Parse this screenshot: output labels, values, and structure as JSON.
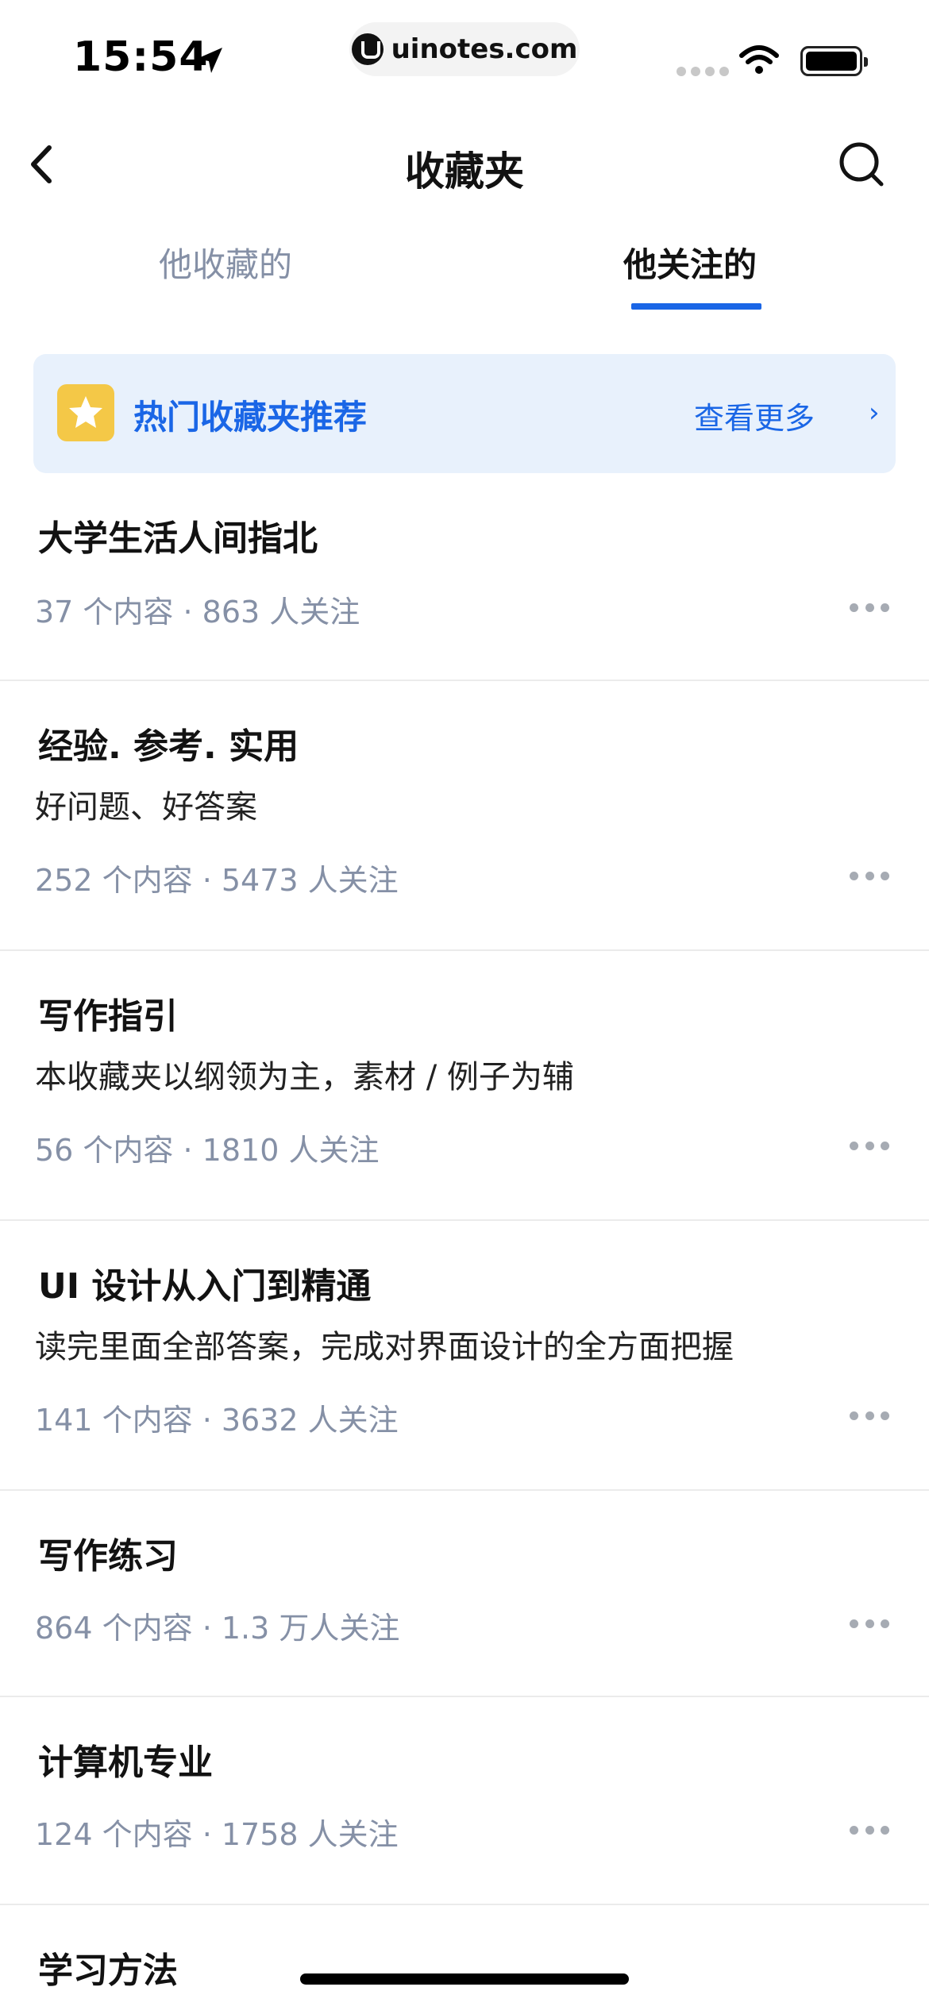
{
  "status_bar": {
    "time": "15:54",
    "url": "uinotes.com"
  },
  "nav": {
    "title": "收藏夹"
  },
  "tabs": [
    {
      "label": "他收藏的",
      "active": false
    },
    {
      "label": "他关注的",
      "active": true
    }
  ],
  "banner": {
    "title": "热门收藏夹推荐",
    "more_label": "查看更多",
    "more_arrow": "›"
  },
  "collections": [
    {
      "title": "大学生活人间指北",
      "description": "",
      "meta": "37 个内容 · 863 人关注"
    },
    {
      "title": "经验. 参考. 实用",
      "description": "好问题、好答案",
      "meta": "252 个内容 · 5473 人关注"
    },
    {
      "title": "写作指引",
      "description": "本收藏夹以纲领为主，素材 / 例子为辅",
      "meta": "56 个内容 · 1810 人关注"
    },
    {
      "title": "UI 设计从入门到精通",
      "description": "读完里面全部答案，完成对界面设计的全方面把握",
      "meta": "141 个内容 · 3632 人关注"
    },
    {
      "title": "写作练习",
      "description": "",
      "meta": "864 个内容 · 1.3 万人关注"
    },
    {
      "title": "计算机专业",
      "description": "",
      "meta": "124 个内容 · 1758 人关注"
    },
    {
      "title": "学习方法",
      "description": "",
      "meta": ""
    }
  ],
  "colors": {
    "accent": "#1a66e6",
    "banner_bg": "#e8f1fc",
    "meta_gray": "#8590a6",
    "star_bg": "#f4c847"
  }
}
